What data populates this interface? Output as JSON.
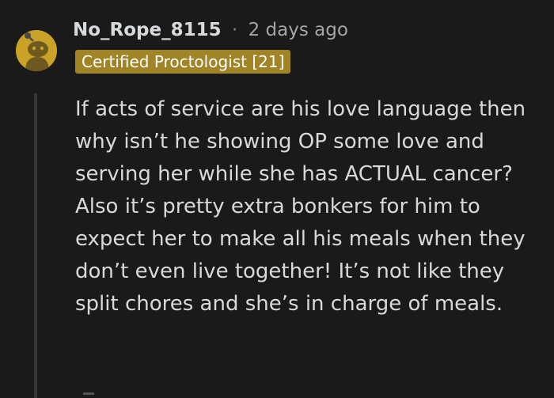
{
  "comment": {
    "username": "No_Rope_8115",
    "separator": "·",
    "timestamp": "2 days ago",
    "flair": "Certified Proctologist [21]",
    "body": "If acts of service are his love language then why isn’t he showing OP some love and serving her while she has ACTUAL cancer? Also it’s pretty extra bonkers for him to expect her to make all his meals when they don’t even live together! It’s not like they split chores and she’s in charge of meals."
  },
  "avatar_icon": "snoo-avatar-icon",
  "colors": {
    "background": "#1a1a1b",
    "text": "#d7dadc",
    "flair_bg": "#a08426",
    "avatar_bg": "#c9a227"
  }
}
